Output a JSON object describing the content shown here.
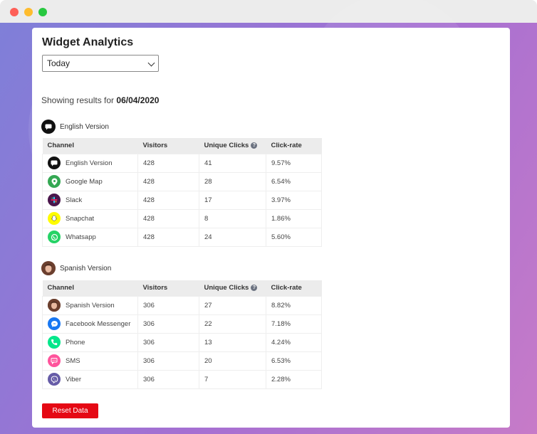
{
  "page": {
    "title": "Widget Analytics",
    "filter": {
      "selected": "Today"
    },
    "showing_prefix": "Showing results for",
    "showing_date": "06/04/2020",
    "reset_label": "Reset Data"
  },
  "sections": [
    {
      "name": "English Version",
      "headers": [
        "Channel",
        "Visitors",
        "Unique Clicks",
        "Click-rate"
      ],
      "rows": [
        {
          "channel": "English Version",
          "icon": "chat-icon",
          "color": "#111111",
          "visitors": "428",
          "clicks": "41",
          "rate": "9.57%"
        },
        {
          "channel": "Google Map",
          "icon": "map-pin-icon",
          "color": "#34a853",
          "visitors": "428",
          "clicks": "28",
          "rate": "6.54%"
        },
        {
          "channel": "Slack",
          "icon": "slack-icon",
          "color": "#4a154b",
          "visitors": "428",
          "clicks": "17",
          "rate": "3.97%"
        },
        {
          "channel": "Snapchat",
          "icon": "snapchat-icon",
          "color": "#fffc00",
          "visitors": "428",
          "clicks": "8",
          "rate": "1.86%"
        },
        {
          "channel": "Whatsapp",
          "icon": "whatsapp-icon",
          "color": "#25d366",
          "visitors": "428",
          "clicks": "24",
          "rate": "5.60%"
        }
      ]
    },
    {
      "name": "Spanish Version",
      "headers": [
        "Channel",
        "Visitors",
        "Unique Clicks",
        "Click-rate"
      ],
      "rows": [
        {
          "channel": "Spanish Version",
          "icon": "avatar-icon",
          "color": "#8a5a44",
          "visitors": "306",
          "clicks": "27",
          "rate": "8.82%"
        },
        {
          "channel": "Facebook Messenger",
          "icon": "messenger-icon",
          "color": "#1877f2",
          "visitors": "306",
          "clicks": "22",
          "rate": "7.18%"
        },
        {
          "channel": "Phone",
          "icon": "phone-icon",
          "color": "#03e78b",
          "visitors": "306",
          "clicks": "13",
          "rate": "4.24%"
        },
        {
          "channel": "SMS",
          "icon": "sms-icon",
          "color": "#ff549c",
          "visitors": "306",
          "clicks": "20",
          "rate": "6.53%"
        },
        {
          "channel": "Viber",
          "icon": "viber-icon",
          "color": "#665ca7",
          "visitors": "306",
          "clicks": "7",
          "rate": "2.28%"
        }
      ]
    }
  ]
}
